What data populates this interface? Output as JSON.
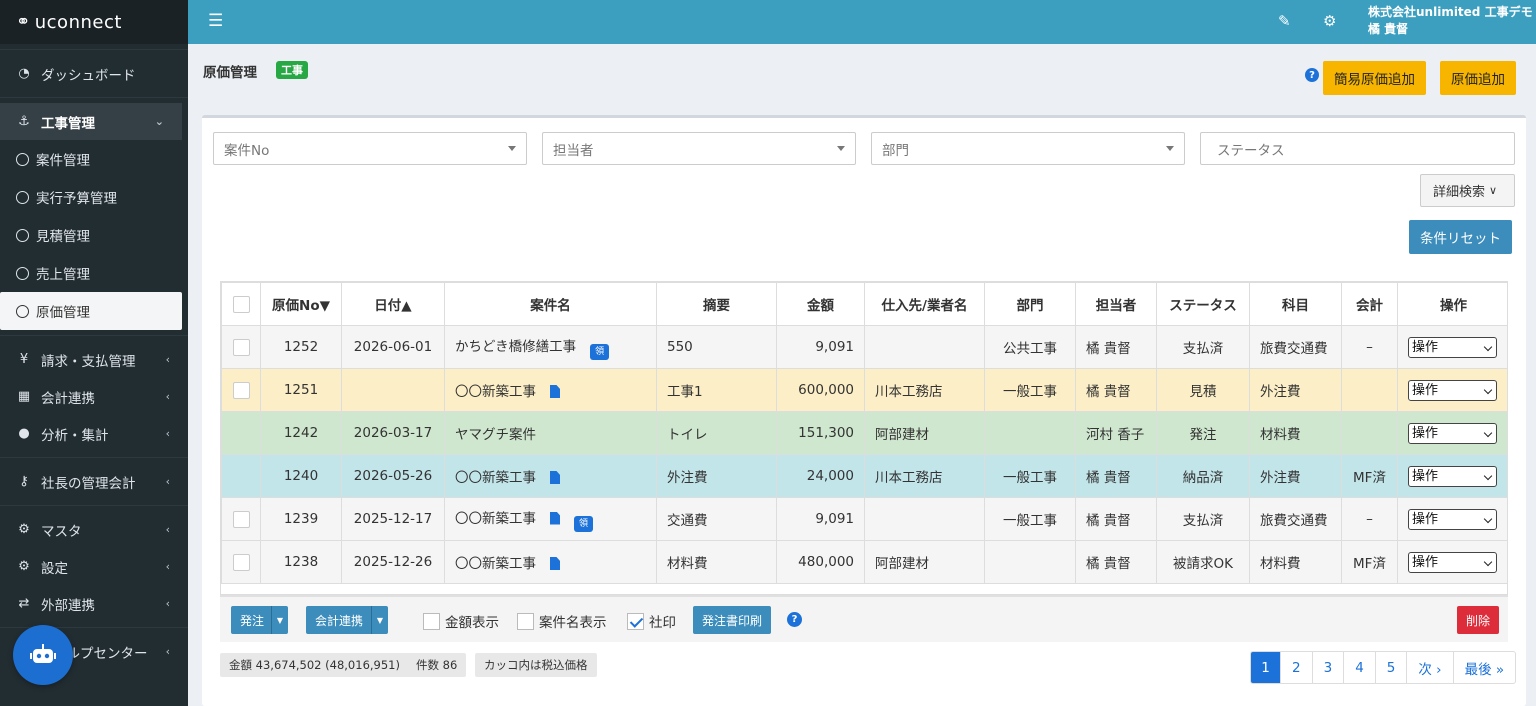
{
  "brand": "uconnect",
  "sidebar": {
    "dashboard": "ダッシュボード",
    "construction": "工事管理",
    "sub_items": [
      "案件管理",
      "実行予算管理",
      "見積管理",
      "売上管理",
      "原価管理"
    ],
    "billing": "請求・支払管理",
    "accounting": "会計連携",
    "analysis": "分析・集計",
    "president": "社長の管理会計",
    "master": "マスタ",
    "settings": "設定",
    "external": "外部連携",
    "help": "ヘルプセンター"
  },
  "topbar": {
    "company": "株式会社unlimited 工事デモ",
    "user": "橘 貴督"
  },
  "page": {
    "title": "原価管理",
    "tag": "工事",
    "help": "?",
    "btn_simple_add": "簡易原価追加",
    "btn_add": "原価追加"
  },
  "filters": {
    "case_no": "案件No",
    "person": "担当者",
    "dept": "部門",
    "status": "ステータス",
    "detail_search": "詳細検索",
    "reset": "条件リセット"
  },
  "table": {
    "headers": [
      "原価No▼",
      "日付▲",
      "案件名",
      "摘要",
      "金額",
      "仕入先/業者名",
      "部門",
      "担当者",
      "ステータス",
      "科目",
      "会計",
      "操作"
    ],
    "op_label": "操作",
    "rows": [
      {
        "no": "1252",
        "date": "2026-06-01",
        "case": "かちどき橋修繕工事",
        "memo": "550",
        "amount": "9,091",
        "vendor": "",
        "dept": "公共工事",
        "person": "橘 貴督",
        "status": "支払済",
        "subject": "旅費交通費",
        "acct": "–"
      },
      {
        "no": "1251",
        "date": "",
        "case": "〇〇新築工事",
        "memo": "工事1",
        "amount": "600,000",
        "vendor": "川本工務店",
        "dept": "一般工事",
        "person": "橘 貴督",
        "status": "見積",
        "subject": "外注費",
        "acct": ""
      },
      {
        "no": "1242",
        "date": "2026-03-17",
        "case": "ヤマグチ案件",
        "memo": "トイレ",
        "amount": "151,300",
        "vendor": "阿部建材",
        "dept": "",
        "person": "河村 香子",
        "status": "発注",
        "subject": "材料費",
        "acct": ""
      },
      {
        "no": "1240",
        "date": "2026-05-26",
        "case": "〇〇新築工事",
        "memo": "外注費",
        "amount": "24,000",
        "vendor": "川本工務店",
        "dept": "一般工事",
        "person": "橘 貴督",
        "status": "納品済",
        "subject": "外注費",
        "acct": "MF済"
      },
      {
        "no": "1239",
        "date": "2025-12-17",
        "case": "〇〇新築工事",
        "memo": "交通費",
        "amount": "9,091",
        "vendor": "",
        "dept": "一般工事",
        "person": "橘 貴督",
        "status": "支払済",
        "subject": "旅費交通費",
        "acct": "–"
      },
      {
        "no": "1238",
        "date": "2025-12-26",
        "case": "〇〇新築工事",
        "memo": "材料費",
        "amount": "480,000",
        "vendor": "阿部建材",
        "dept": "",
        "person": "橘 貴督",
        "status": "被請求OK",
        "subject": "材料費",
        "acct": "MF済"
      }
    ]
  },
  "actions": {
    "order": "発注",
    "accounting": "会計連携",
    "show_amount": "金額表示",
    "show_case": "案件名表示",
    "seal": "社印",
    "print": "発注書印刷",
    "delete": "削除"
  },
  "summary": {
    "amount": "金額 43,674,502 (48,016,951)",
    "count": "件数 86",
    "note": "カッコ内は税込価格"
  },
  "pager": [
    "1",
    "2",
    "3",
    "4",
    "5",
    "次 ›",
    "最後 »"
  ]
}
